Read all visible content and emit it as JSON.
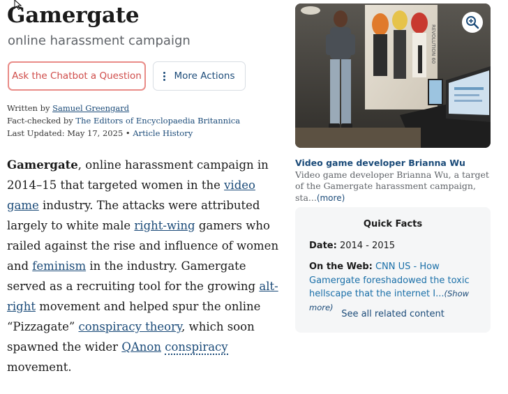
{
  "article": {
    "title": "Gamergate",
    "subtitle": "online harassment campaign",
    "buttons": {
      "chatbot": "Ask the Chatbot a Question",
      "more_actions": "More Actions"
    },
    "meta": {
      "written_by_label": "Written by",
      "author": "Samuel Greengard",
      "fact_checked_label": "Fact-checked by",
      "fact_checker": "The Editors of Encyclopaedia Britannica",
      "last_updated_label": "Last Updated: May 17, 2025",
      "separator": "•",
      "history_link": "Article History"
    },
    "body": {
      "term": "Gamergate",
      "t1": ", online harassment campaign in 2014–15 that targeted women in the ",
      "link_video_game": "video game",
      "t2": " industry. The attacks were attributed largely to white male ",
      "link_right_wing": "right-wing",
      "t3": " gamers who railed against the rise and influence of women and ",
      "link_feminism": "feminism",
      "t4": " in the industry. Gamergate served as a recruiting tool for the growing ",
      "link_alt_right": "alt-right",
      "t5": " movement and helped spur the online “Pizzagate” ",
      "link_conspiracy_theory": "conspiracy theory",
      "t6": ", which soon spawned the wider ",
      "link_qanon": "QAnon",
      "t7": " ",
      "link_conspiracy": "conspiracy",
      "t8": " movement."
    }
  },
  "sidebar": {
    "image_caption": {
      "title": "Video game developer Brianna Wu",
      "text": "Video game developer Brianna Wu, a target of the Gamergate harassment campaign, sta...",
      "more": "(more)"
    },
    "quick_facts": {
      "title": "Quick Facts",
      "date_label": "Date:",
      "date_value": "2014 - 2015",
      "web_label": "On the Web:",
      "web_link": "CNN US - How Gamergate foreshadowed the toxic hellscape that the internet I...",
      "show_more": "(Show more)",
      "see_all": "See all related content"
    }
  },
  "icons": {
    "zoom": "magnifier-plus-icon",
    "more_actions": "vertical-ellipsis-icon",
    "cursor": "mouse-pointer-icon"
  },
  "colors": {
    "link": "#1a4a78",
    "chatbot_border": "#e98b87",
    "chatbot_text": "#cf4c4a",
    "quick_facts_bg": "#f5f6f7"
  }
}
